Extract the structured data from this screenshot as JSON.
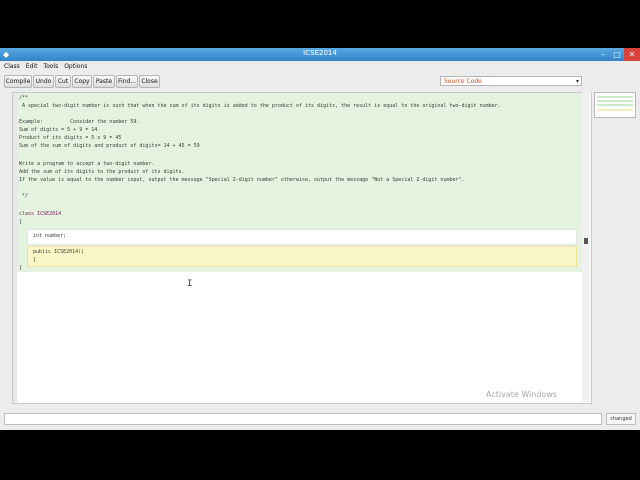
{
  "window": {
    "title": "ICSE2014",
    "app_icon": "bluej-icon",
    "controls": {
      "minimize": "–",
      "maximize": "□",
      "close": "✕"
    }
  },
  "menubar": {
    "items": [
      "Class",
      "Edit",
      "Tools",
      "Options"
    ]
  },
  "toolbar": {
    "buttons": [
      "Compile",
      "Undo",
      "Cut",
      "Copy",
      "Paste",
      "Find...",
      "Close"
    ],
    "view_select": "Source Code"
  },
  "editor": {
    "comment_lines": [
      "/**",
      " A special two-digit number is such that when the sum of its digits is added to the product of its digits, the result is equal to the original two-digit number.",
      "",
      "Example:         Consider the number 59.",
      "Sum of digits = 5 + 9 = 14",
      "Product of its digits = 5 x 9 = 45",
      "Sum of the sum of digits and product of digits= 14 + 45 = 59",
      "",
      "Write a program to accept a two-digit number.",
      "Add the sum of its digits to the product of its digits.",
      "If the value is equal to the number input, output the message \"Special 2-digit number\" otherwise, output the message \"Not a Special 2-digit number\".",
      "",
      " */"
    ],
    "class_decl": "class ICSE2014",
    "open_brace": "{",
    "field_line": "int number;",
    "constructor_line": "public ICSE2014()",
    "constructor_brace": "{",
    "close_brace": "}"
  },
  "watermark": "Activate Windows",
  "statusbar": {
    "message": "",
    "state_label": "changed"
  }
}
